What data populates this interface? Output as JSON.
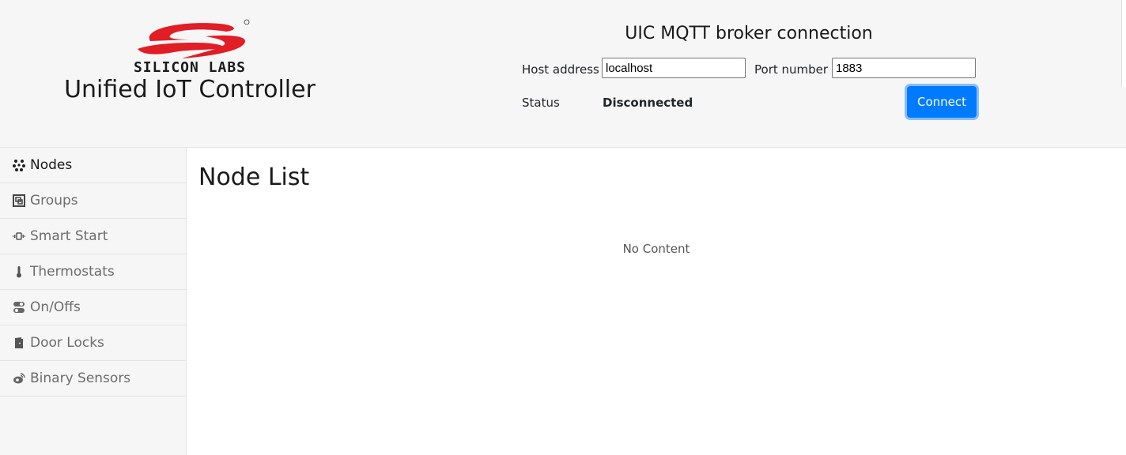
{
  "brand": {
    "logo_text": "SILICON LABS",
    "app_title": "Unified IoT Controller",
    "logo_color": "#e11d26"
  },
  "connection": {
    "title": "UIC MQTT broker connection",
    "host_label": "Host address",
    "host_value": "localhost",
    "port_label": "Port number",
    "port_value": "1883",
    "status_label": "Status",
    "status_value": "Disconnected",
    "connect_label": "Connect",
    "accent_color": "#007bff"
  },
  "sidebar": {
    "items": [
      {
        "label": "Nodes",
        "icon": "nodes-icon",
        "active": true
      },
      {
        "label": "Groups",
        "icon": "groups-icon",
        "active": false
      },
      {
        "label": "Smart Start",
        "icon": "smart-start-icon",
        "active": false
      },
      {
        "label": "Thermostats",
        "icon": "thermometer-icon",
        "active": false
      },
      {
        "label": "On/Offs",
        "icon": "toggle-icon",
        "active": false
      },
      {
        "label": "Door Locks",
        "icon": "door-icon",
        "active": false
      },
      {
        "label": "Binary Sensors",
        "icon": "sensor-icon",
        "active": false
      }
    ]
  },
  "main": {
    "title": "Node List",
    "empty_text": "No Content"
  }
}
